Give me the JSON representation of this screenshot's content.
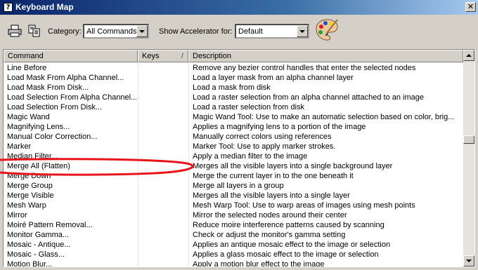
{
  "window": {
    "title": "Keyboard Map",
    "close_glyph": "✕"
  },
  "toolbar": {
    "category_label": "Category:",
    "category_value": "All Commands",
    "accelerator_label": "Show Accelerator for:",
    "accelerator_value": "Default",
    "icons": [
      "print-icon",
      "copy-icon",
      "palette-icon"
    ]
  },
  "table": {
    "columns": {
      "command": "Command",
      "keys": "Keys",
      "description": "Description"
    },
    "sort_glyph": "/",
    "rows": [
      {
        "command": "Line Before",
        "keys": "",
        "description": "Remove any bezier control handles that enter the selected nodes"
      },
      {
        "command": "Load Mask From Alpha Channel...",
        "keys": "",
        "description": "Load a layer mask from an alpha channel layer"
      },
      {
        "command": "Load Mask From Disk...",
        "keys": "",
        "description": "Load a mask from disk"
      },
      {
        "command": "Load Selection From Alpha Channel...",
        "keys": "",
        "description": "Load a raster selection from an alpha channel attached to an image"
      },
      {
        "command": "Load Selection From Disk...",
        "keys": "",
        "description": "Load a raster selection from disk"
      },
      {
        "command": "Magic Wand",
        "keys": "",
        "description": "Magic Wand Tool: Use to make an automatic selection based on color, brig..."
      },
      {
        "command": "Magnifying Lens...",
        "keys": "",
        "description": "Applies a magnifying lens to a portion of the image"
      },
      {
        "command": "Manual Color Correction...",
        "keys": "",
        "description": "Manually correct colors using references"
      },
      {
        "command": "Marker",
        "keys": "",
        "description": "Marker Tool: Use to apply marker strokes."
      },
      {
        "command": "Median Filter...",
        "keys": "",
        "description": "Apply a median filter to the image"
      },
      {
        "command": "Merge All (Flatten)",
        "keys": "",
        "description": "Merges all the visible layers into a single background layer"
      },
      {
        "command": "Merge Down",
        "keys": "",
        "description": "Merge the current layer in to the one beneath it"
      },
      {
        "command": "Merge Group",
        "keys": "",
        "description": "Merge all layers in a group"
      },
      {
        "command": "Merge Visible",
        "keys": "",
        "description": "Merges all the visible layers into a single layer"
      },
      {
        "command": "Mesh Warp",
        "keys": "",
        "description": "Mesh Warp Tool: Use to warp areas of images using mesh points"
      },
      {
        "command": "Mirror",
        "keys": "",
        "description": "Mirror the selected nodes around their center"
      },
      {
        "command": "Moiré Pattern Removal...",
        "keys": "",
        "description": "Reduce moire interference patterns caused by scanning"
      },
      {
        "command": "Monitor Gamma...",
        "keys": "",
        "description": "Check or adjust the monitor's gamma setting"
      },
      {
        "command": "Mosaic - Antique...",
        "keys": "",
        "description": "Applies an antique mosaic effect to the image or selection"
      },
      {
        "command": "Mosaic - Glass...",
        "keys": "",
        "description": "Applies a glass mosaic effect to the image or selection"
      },
      {
        "command": "Motion Blur...",
        "keys": "",
        "description": "Apply a motion blur effect to the image"
      }
    ]
  },
  "annotation": {
    "color": "#e8141b",
    "highlighted_row": "Merge All (Flatten)"
  },
  "colors": {
    "titlebar_start": "#0a246a",
    "titlebar_end": "#a6caf0",
    "chrome": "#d4d0c8"
  }
}
